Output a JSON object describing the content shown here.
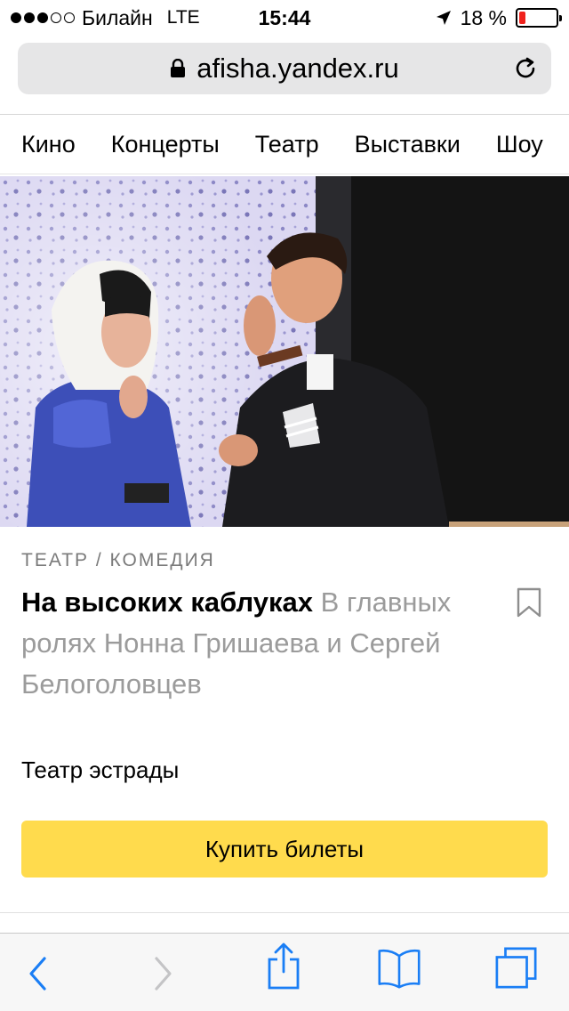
{
  "status_bar": {
    "carrier": "Билайн",
    "network": "LTE",
    "time": "15:44",
    "battery_percent_text": "18 %",
    "battery_level": 0.18,
    "signal_bars_filled": 3,
    "signal_bars_total": 5
  },
  "url_bar": {
    "url": "afisha.yandex.ru"
  },
  "category_nav": {
    "items": [
      "Кино",
      "Концерты",
      "Театр",
      "Выставки",
      "Шоу"
    ]
  },
  "event": {
    "category": "ТЕАТР / КОМЕДИЯ",
    "title": "На высоких каблуках",
    "subtitle": "В главных ролях Нонна Гришаева и Сергей Белоголовцев",
    "venue": "Театр эстрады",
    "buy_label": "Купить билеты"
  },
  "colors": {
    "accent_button": "#ffdb4d",
    "ios_blue": "#1a7ef5",
    "battery_low": "#f0221d"
  },
  "icons": {
    "back": "chevron-left-icon",
    "forward": "chevron-right-icon",
    "share": "share-icon",
    "bookmarks": "book-icon",
    "tabs": "tabs-icon",
    "reload": "reload-icon",
    "lock": "lock-icon",
    "bookmark": "bookmark-icon",
    "location": "location-arrow-icon"
  }
}
